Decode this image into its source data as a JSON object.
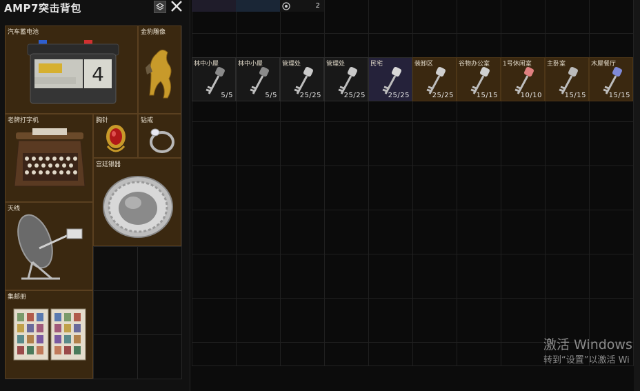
{
  "backpack": {
    "title": "AMP7突击背包",
    "items": [
      {
        "label": "汽车蓄电池",
        "icon": "car-battery-icon"
      },
      {
        "label": "金豹雕像",
        "icon": "golden-leopard-statue-icon"
      },
      {
        "label": "老牌打字机",
        "icon": "typewriter-icon"
      },
      {
        "label": "胸针",
        "icon": "brooch-icon"
      },
      {
        "label": "钻戒",
        "icon": "diamond-ring-icon"
      },
      {
        "label": "宫廷银器",
        "icon": "silver-plate-icon"
      },
      {
        "label": "天线",
        "icon": "satellite-dish-icon"
      },
      {
        "label": "集邮册",
        "icon": "stamp-album-icon"
      }
    ],
    "battery_digit": "4"
  },
  "stash": {
    "top_row_count": "2",
    "keys": [
      {
        "label": "林中小屋",
        "count": "5/5",
        "color": "#8a8a8a",
        "tint": "dark"
      },
      {
        "label": "林中小屋",
        "count": "5/5",
        "color": "#8a8a8a",
        "tint": "dark"
      },
      {
        "label": "管理处",
        "count": "25/25",
        "color": "#c9c9c9",
        "tint": "dark"
      },
      {
        "label": "管理处",
        "count": "25/25",
        "color": "#c9c9c9",
        "tint": "dark"
      },
      {
        "label": "民宅",
        "count": "25/25",
        "color": "#d8d8d8",
        "tint": "purple"
      },
      {
        "label": "装卸区",
        "count": "25/25",
        "color": "#cfcfcf",
        "tint": "brown"
      },
      {
        "label": "谷物办公室",
        "count": "15/15",
        "color": "#d0d0d0",
        "tint": "brown"
      },
      {
        "label": "1号休闲室",
        "count": "10/10",
        "color": "#e08080",
        "tint": "brown"
      },
      {
        "label": "主卧室",
        "count": "15/15",
        "color": "#bbbbbb",
        "tint": "brown"
      },
      {
        "label": "木屋餐厅",
        "count": "15/15",
        "color": "#7f8ad8",
        "tint": "brown"
      }
    ]
  },
  "watermark": {
    "line1": "激活 Windows",
    "line2": "转到“设置”以激活 Wi"
  }
}
